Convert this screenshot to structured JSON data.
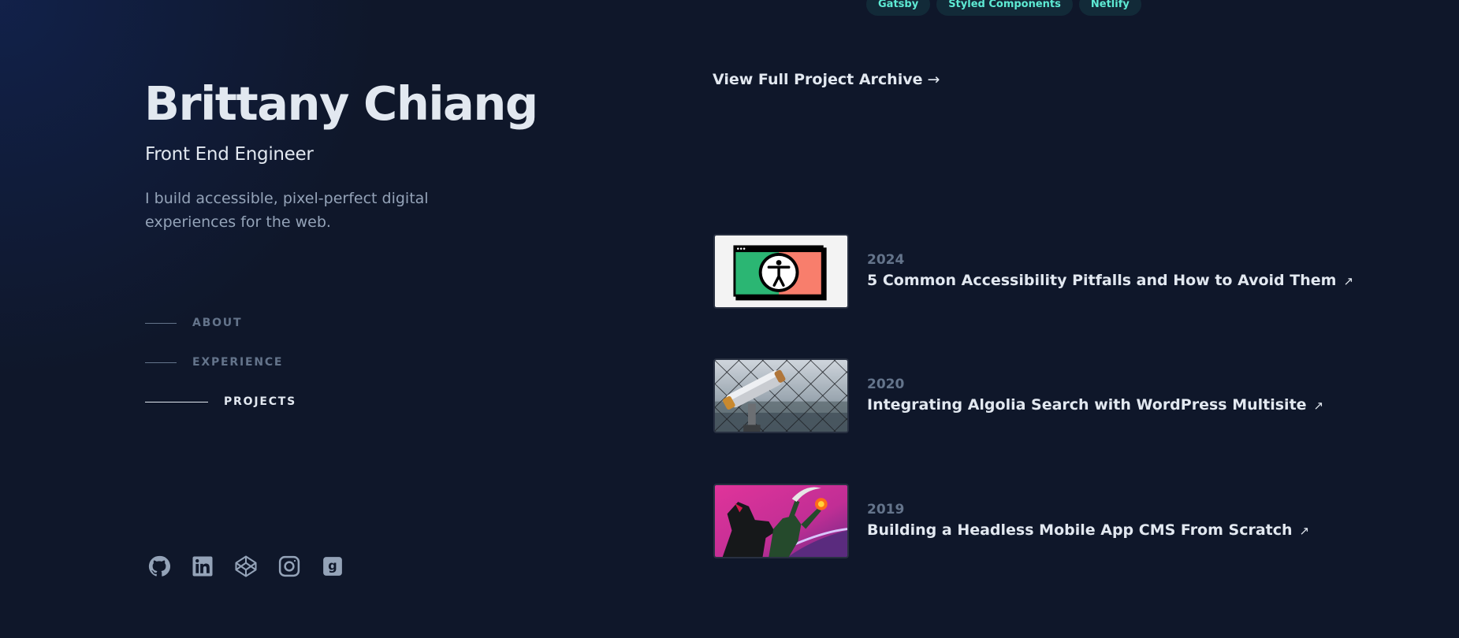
{
  "profile": {
    "name": "Brittany Chiang",
    "role": "Front End Engineer",
    "tagline": "I build accessible, pixel-perfect digital experiences for the web."
  },
  "nav": {
    "items": [
      {
        "label": "ABOUT",
        "active": false
      },
      {
        "label": "EXPERIENCE",
        "active": false
      },
      {
        "label": "PROJECTS",
        "active": true
      }
    ]
  },
  "socials": [
    {
      "icon": "github-icon"
    },
    {
      "icon": "linkedin-icon"
    },
    {
      "icon": "codepen-icon"
    },
    {
      "icon": "instagram-icon"
    },
    {
      "icon": "goodreads-icon"
    }
  ],
  "project_tags": [
    "Gatsby",
    "Styled Components",
    "Netlify"
  ],
  "archive": {
    "label": "View Full Project Archive",
    "arrow": "→"
  },
  "writing": [
    {
      "year": "2024",
      "title": "5 Common Accessibility Pitfalls and How to Avoid Them",
      "arrow": "↗",
      "image": "accessibility-illustration"
    },
    {
      "year": "2020",
      "title": "Integrating Algolia Search with WordPress Multisite",
      "arrow": "↗",
      "image": "telescope-photo"
    },
    {
      "year": "2019",
      "title": "Building a Headless Mobile App CMS From Scratch",
      "arrow": "↗",
      "image": "headless-horseman-illustration"
    }
  ],
  "colors": {
    "background": "#0f172a",
    "heading": "#e2e8f0",
    "body": "#94a3b8",
    "muted": "#64748b",
    "accent": "#5eead4"
  }
}
